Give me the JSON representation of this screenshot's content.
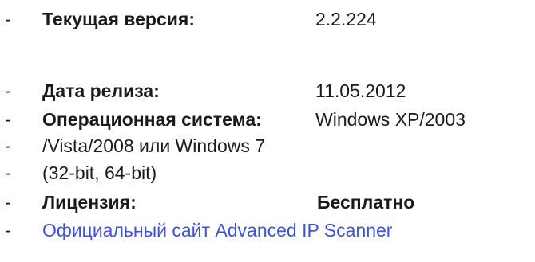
{
  "bullet": "-",
  "info": {
    "version_label": "Текущая версия:",
    "version_value": "2.2.224",
    "date_label": "Дата релиза:",
    "date_value": "11.05.2012",
    "os_label": "Операционная система:",
    "os_value_line1": "Windows XP/2003",
    "os_value_line2": "/Vista/2008 или Windows 7",
    "os_value_line3": "(32-bit, 64-bit)",
    "license_label": "Лицензия:",
    "license_value": "Бесплатно",
    "site_link": "Официальный сайт Advanced IP Scanner"
  },
  "colors": {
    "text": "#1a1a1a",
    "link": "#3f51d9",
    "background": "#ffffff"
  }
}
